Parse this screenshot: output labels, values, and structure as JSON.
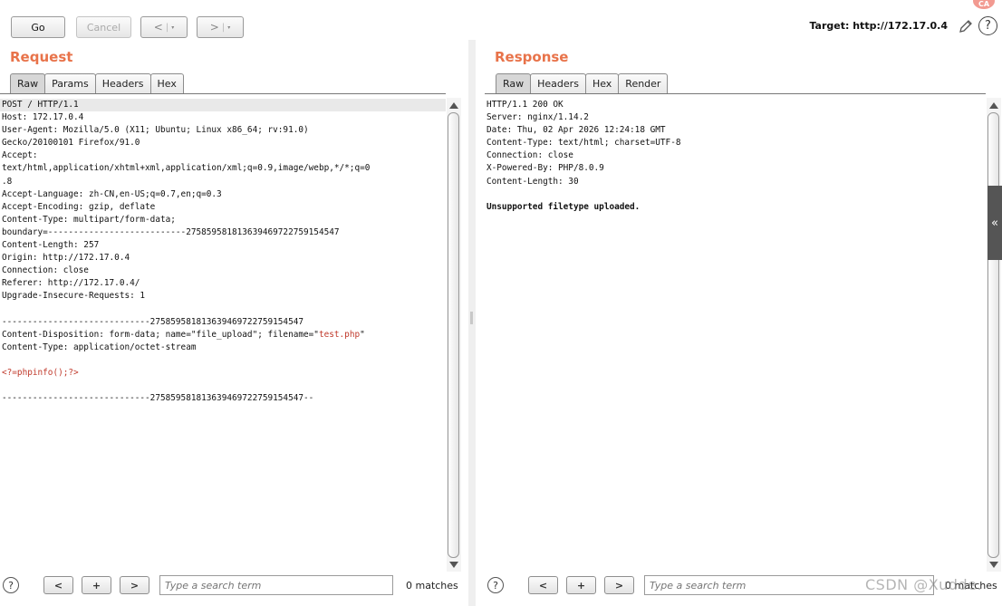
{
  "toolbar": {
    "go_label": "Go",
    "cancel_label": "Cancel",
    "back_glyph": "<",
    "forward_glyph": ">",
    "dropdown_glyph": "▾",
    "target_label": "Target: http://172.17.0.4",
    "edit_icon": "pencil-icon",
    "help_glyph": "?",
    "avatar_text": "CA"
  },
  "request": {
    "title": "Request",
    "tabs": [
      "Raw",
      "Params",
      "Headers",
      "Hex"
    ],
    "active_tab": "Raw",
    "lines": [
      "POST / HTTP/1.1",
      "Host: 172.17.0.4",
      "User-Agent: Mozilla/5.0 (X11; Ubuntu; Linux x86_64; rv:91.0)",
      "Gecko/20100101 Firefox/91.0",
      "Accept:",
      "text/html,application/xhtml+xml,application/xml;q=0.9,image/webp,*/*;q=0",
      ".8",
      "Accept-Language: zh-CN,en-US;q=0.7,en;q=0.3",
      "Accept-Encoding: gzip, deflate",
      "Content-Type: multipart/form-data;",
      "boundary=---------------------------275859581813639469722759154547",
      "Content-Length: 257",
      "Origin: http://172.17.0.4",
      "Connection: close",
      "Referer: http://172.17.0.4/",
      "Upgrade-Insecure-Requests: 1",
      "",
      "-----------------------------275859581813639469722759154547",
      "Content-Disposition: form-data; name=\"file_upload\"; filename=\"",
      "Content-Type: application/octet-stream",
      "",
      "<?=phpinfo();?>",
      "",
      "-----------------------------275859581813639469722759154547--"
    ],
    "filename_value": "test.php",
    "filename_suffix": "\""
  },
  "response": {
    "title": "Response",
    "tabs": [
      "Raw",
      "Headers",
      "Hex",
      "Render"
    ],
    "active_tab": "Raw",
    "lines": [
      "HTTP/1.1 200 OK",
      "Server: nginx/1.14.2",
      "Date: Thu, 02 Apr 2026 12:24:18 GMT",
      "Content-Type: text/html; charset=UTF-8",
      "Connection: close",
      "X-Powered-By: PHP/8.0.9",
      "Content-Length: 30",
      "",
      "Unsupported filetype uploaded."
    ]
  },
  "search": {
    "placeholder": "Type a search term",
    "prev_glyph": "<",
    "add_glyph": "+",
    "next_glyph": ">",
    "help_glyph": "?",
    "request_matches": "0 matches",
    "response_matches": "0 matches"
  },
  "side": {
    "collapse_glyph": "«"
  },
  "watermark": "CSDN @Xudde."
}
